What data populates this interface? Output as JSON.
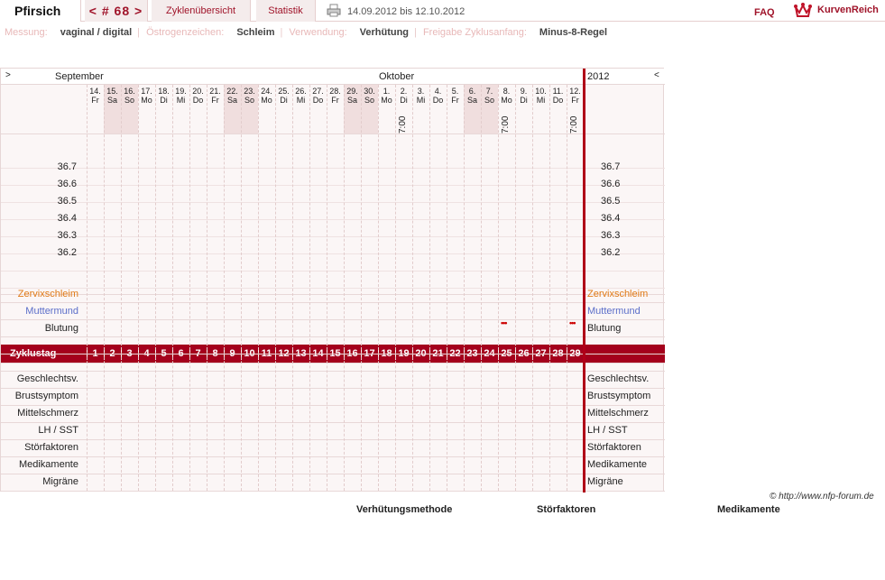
{
  "header": {
    "user": "Pfirsich",
    "cycle_nav": "< # 68 >",
    "tabs": [
      "Zyklenübersicht",
      "Statistik"
    ],
    "date_range": "14.09.2012 bis 12.10.2012",
    "faq": "FAQ",
    "brand": "KurvenReich"
  },
  "settings": [
    {
      "key": "Messung:",
      "value": "vaginal / digital"
    },
    {
      "key": "Östrogenzeichen:",
      "value": "Schleim"
    },
    {
      "key": "Verwendung:",
      "value": "Verhütung"
    },
    {
      "key": "Freigabe Zyklusanfang:",
      "value": "Minus-8-Regel"
    }
  ],
  "chart": {
    "nav_prev": ">",
    "nav_next": "<",
    "month_sep": "September",
    "month_oct": "Oktober",
    "year": "2012",
    "days": [
      {
        "d": "14.",
        "w": "Fr",
        "we": false
      },
      {
        "d": "15.",
        "w": "Sa",
        "we": true
      },
      {
        "d": "16.",
        "w": "So",
        "we": true
      },
      {
        "d": "17.",
        "w": "Mo",
        "we": false
      },
      {
        "d": "18.",
        "w": "Di",
        "we": false
      },
      {
        "d": "19.",
        "w": "Mi",
        "we": false
      },
      {
        "d": "20.",
        "w": "Do",
        "we": false
      },
      {
        "d": "21.",
        "w": "Fr",
        "we": false
      },
      {
        "d": "22.",
        "w": "Sa",
        "we": true
      },
      {
        "d": "23.",
        "w": "So",
        "we": true
      },
      {
        "d": "24.",
        "w": "Mo",
        "we": false
      },
      {
        "d": "25.",
        "w": "Di",
        "we": false
      },
      {
        "d": "26.",
        "w": "Mi",
        "we": false
      },
      {
        "d": "27.",
        "w": "Do",
        "we": false
      },
      {
        "d": "28.",
        "w": "Fr",
        "we": false
      },
      {
        "d": "29.",
        "w": "Sa",
        "we": true
      },
      {
        "d": "30.",
        "w": "So",
        "we": true
      },
      {
        "d": "1.",
        "w": "Mo",
        "we": false
      },
      {
        "d": "2.",
        "w": "Di",
        "we": false
      },
      {
        "d": "3.",
        "w": "Mi",
        "we": false
      },
      {
        "d": "4.",
        "w": "Do",
        "we": false
      },
      {
        "d": "5.",
        "w": "Fr",
        "we": false
      },
      {
        "d": "6.",
        "w": "Sa",
        "we": true
      },
      {
        "d": "7.",
        "w": "So",
        "we": true
      },
      {
        "d": "8.",
        "w": "Mo",
        "we": false
      },
      {
        "d": "9.",
        "w": "Di",
        "we": false
      },
      {
        "d": "10.",
        "w": "Mi",
        "we": false
      },
      {
        "d": "11.",
        "w": "Do",
        "we": false
      },
      {
        "d": "12.",
        "w": "Fr",
        "we": false
      }
    ],
    "time_labels": [
      {
        "day_index": 18,
        "text": "7:00"
      },
      {
        "day_index": 24,
        "text": "7:00"
      },
      {
        "day_index": 28,
        "text": "7:00"
      }
    ],
    "temperatures": [
      "36.7",
      "36.6",
      "36.5",
      "36.4",
      "36.3",
      "36.2"
    ],
    "rows_top": [
      {
        "label": "Zervixschleim",
        "cls": "orange"
      },
      {
        "label": "Muttermund",
        "cls": "blue"
      },
      {
        "label": "Blutung",
        "cls": ""
      }
    ],
    "bleeding_day_indices": [
      24,
      28
    ],
    "zyklustag_label": "Zyklustag",
    "cycle_days": [
      "1",
      "2",
      "3",
      "4",
      "5",
      "6",
      "7",
      "8",
      "9",
      "10",
      "11",
      "12",
      "13",
      "14",
      "15",
      "16",
      "17",
      "18",
      "19",
      "20",
      "21",
      "22",
      "23",
      "24",
      "25",
      "26",
      "27",
      "28",
      "29"
    ],
    "rows_bottom": [
      "Geschlechtsv.",
      "Brustsymptom",
      "Mittelschmerz",
      "LH / SST",
      "Störfaktoren",
      "Medikamente",
      "Migräne"
    ]
  },
  "footer": {
    "copyright": "© http://www.nfp-forum.de",
    "legends": [
      "Verhütungsmethode",
      "Störfaktoren",
      "Medikamente"
    ]
  }
}
